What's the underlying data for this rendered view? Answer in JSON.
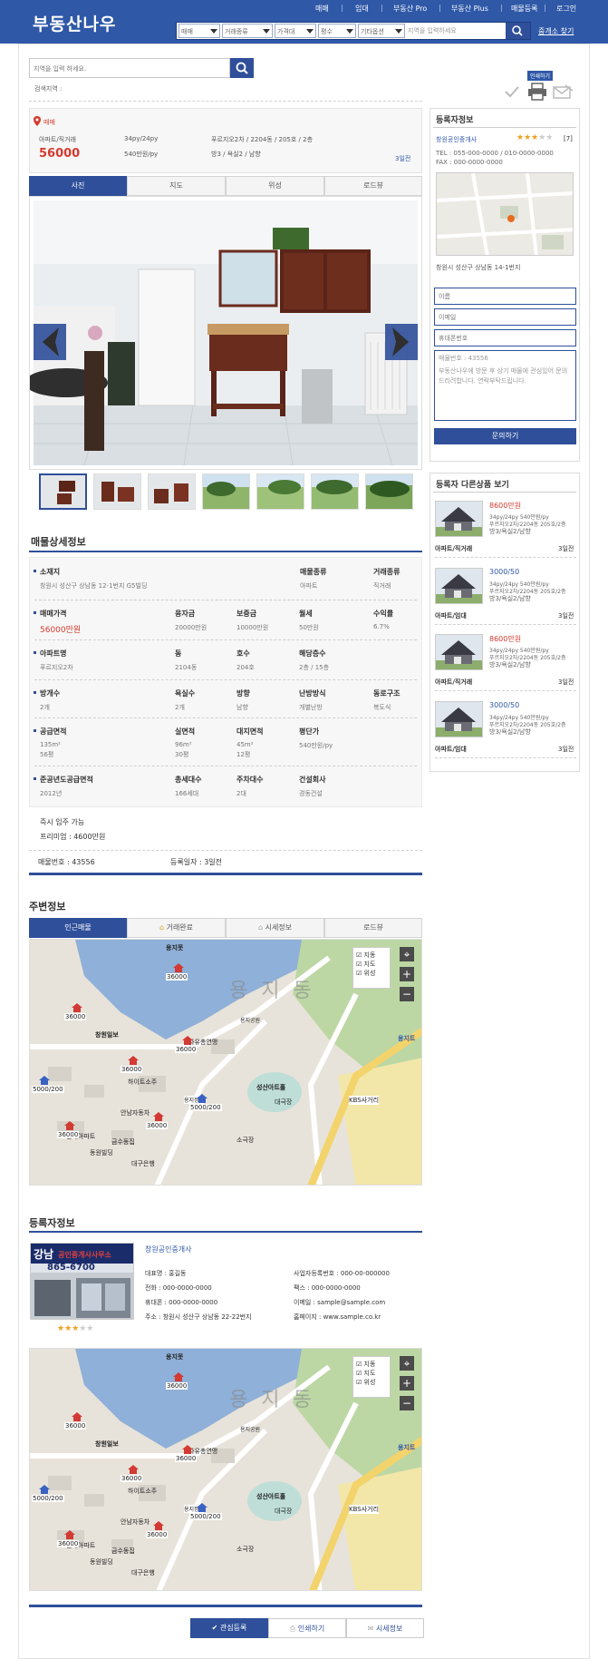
{
  "header": {
    "logo": "부동산나우",
    "nav": [
      "매매",
      "임대",
      "부동산 Pro",
      "부동산 Plus",
      "매물등록",
      "로그인"
    ],
    "filters": [
      "매매",
      "거래종류",
      "가격대",
      "평수",
      "기타옵션"
    ],
    "search_placeholder": "지역을 입력하세요",
    "broker_link": "중개소 찾기"
  },
  "search": {
    "placeholder": "지역을 입력 하세요.",
    "label": "검색지역 :",
    "print_badge": "인쇄하기"
  },
  "listing": {
    "tag": "매매",
    "type": "아파트/직거래",
    "price": "56000",
    "size": "34py/24py",
    "ppy": "540만원/py",
    "building": "푸르지오2차 / 2204동 / 205호 / 2층",
    "rooms": "방3 / 욕실2 / 남향",
    "date": "3일전"
  },
  "photo_tabs": [
    "사진",
    "지도",
    "위성",
    "로드뷰"
  ],
  "detail": {
    "title": "매물상세정보",
    "rows": [
      {
        "cells": [
          {
            "l": "소재지",
            "v": "창원시 성산구 상남동 12-1번지 G5빌딩"
          },
          {
            "l": "매물종류",
            "v": "아파트"
          },
          {
            "l": "거래종류",
            "v": "직거래"
          }
        ]
      },
      {
        "cells": [
          {
            "l": "매매가격",
            "v": "56000만원"
          },
          {
            "l": "융자금",
            "v": "20000만원"
          },
          {
            "l": "보증금",
            "v": "10000만원"
          },
          {
            "l": "월세",
            "v": "50만원"
          },
          {
            "l": "수익률",
            "v": "6.7%"
          }
        ]
      },
      {
        "cells": [
          {
            "l": "아파트명",
            "v": "푸르지오2차"
          },
          {
            "l": "동",
            "v": "2104동"
          },
          {
            "l": "호수",
            "v": "204호"
          },
          {
            "l": "해당층수",
            "v": "2층 / 15층"
          }
        ]
      },
      {
        "cells": [
          {
            "l": "방개수",
            "v": "2개"
          },
          {
            "l": "욕실수",
            "v": "2개"
          },
          {
            "l": "방향",
            "v": "남향"
          },
          {
            "l": "난방방식",
            "v": "개별난방"
          },
          {
            "l": "동로구조",
            "v": "복도식"
          }
        ]
      },
      {
        "cells": [
          {
            "l": "공급면적",
            "v": "135m²",
            "v2": "56평"
          },
          {
            "l": "실면적",
            "v": "96m²",
            "v2": "30평"
          },
          {
            "l": "대지면적",
            "v": "45m²",
            "v2": "12평"
          },
          {
            "l": "평단가",
            "v": "540만원/py"
          }
        ]
      },
      {
        "cells": [
          {
            "l": "준공년도공급면적",
            "v": "2012년"
          },
          {
            "l": "총세대수",
            "v": "166세대"
          },
          {
            "l": "주차대수",
            "v": "2대"
          },
          {
            "l": "건설회사",
            "v": "경동건설"
          }
        ]
      }
    ],
    "notes": [
      "즉시 입주 가능",
      "프리미엄 : 4600만원"
    ],
    "listing_no": "매물번호 : 43556",
    "reg_date": "등록일자 : 3일전"
  },
  "nearby": {
    "title": "주변정보",
    "tabs": [
      "인근매물",
      "거래완료",
      "시세정보",
      "로드뷰"
    ]
  },
  "map": {
    "checks": [
      "지동",
      "지도",
      "위성"
    ],
    "labels": [
      "용지못",
      "창원일보",
      "자유총연맹",
      "용지공원",
      "성산아트홀",
      "대극장",
      "소극장",
      "KBS사거리",
      "현대아파트",
      "안남자동차",
      "금수동집",
      "대구은행",
      "동원빌딩",
      "하이트소주",
      "용지트",
      "용지정형"
    ],
    "prices": [
      "36000",
      "36000",
      "36000",
      "36000",
      "36000",
      "36000",
      "5000/200",
      "5000/200"
    ],
    "watermark": "용 지 동"
  },
  "agent_section": {
    "title": "등록자정보",
    "office": "창원공인중개사",
    "sign_line1": "강남",
    "sign_line2": "공인중개사사무소",
    "sign_phone": "865-6700",
    "info": [
      "대표명 : 홍길동",
      "사업자등록번호 : 000-00-000000",
      "전화 : 000-0000-0000",
      "팩스 : 000-0000-0000",
      "휴대폰 : 000-0000-0000",
      "이메일 : sample@sample.com",
      "주소 : 창원시 성산구 상남동 22-22번지",
      "홈페이지 : www.sample.co.kr"
    ]
  },
  "sidebar": {
    "title": "등록자정보",
    "office": "창원공인중개사",
    "rating_count": "[7]",
    "tel": "TEL : 055-000-0000 / 010-0000-0000",
    "fax": "FAX : 000-0000-0000",
    "address": "창원시 성산구 상남동 14-1번지",
    "form": {
      "name": "이름",
      "email": "이메일",
      "phone": "휴대폰번호",
      "msg1": "매물번호 : 43556",
      "msg2": "부동산나우에 방문 후 상기 매물에 관심있어 문의 드리려합니다. 연락부탁드립니다.",
      "button": "문의하기"
    },
    "others_title": "등록자 다른상품 보기",
    "others": [
      {
        "price": "8600만원",
        "l1": "34py/24py 540만원/py",
        "l2": "푸르지오2차/2204동 205호/2층",
        "l3": "방3/욕실2/남향",
        "type": "아파트/직거래",
        "date": "3일전",
        "red": true
      },
      {
        "price": "3000/50",
        "l1": "34py/24py 540만원/py",
        "l2": "푸르지오2차/2204동 205호/2층",
        "l3": "방3/욕실2/남향",
        "type": "아파트/임대",
        "date": "3일전",
        "red": false
      },
      {
        "price": "8600만원",
        "l1": "34py/24py 540만원/py",
        "l2": "푸르지오2차/2204동 205호/2층",
        "l3": "방3/욕실2/남향",
        "type": "아파트/직거래",
        "date": "3일전",
        "red": true
      },
      {
        "price": "3000/50",
        "l1": "34py/24py 540만원/py",
        "l2": "푸르지오2차/2204동 205호/2층",
        "l3": "방3/욕실2/남향",
        "type": "아파트/임대",
        "date": "3일전",
        "red": false
      }
    ]
  },
  "bottom_buttons": [
    "관심등록",
    "인쇄하기",
    "시세정보"
  ],
  "colors": {
    "brand": "#2f58a7",
    "accent": "#2f4f9a",
    "price_red": "#d53a2f",
    "star": "#f0a020"
  }
}
